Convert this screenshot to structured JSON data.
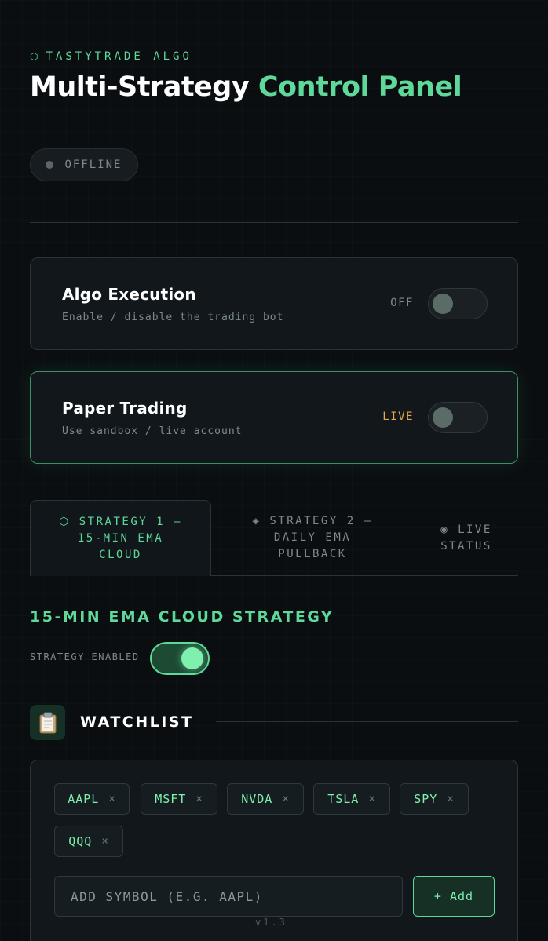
{
  "brand": {
    "icon": "hexagon-icon",
    "label": "TASTYTRADE ALGO"
  },
  "header": {
    "title_main": "Multi-Strategy ",
    "title_accent": "Control Panel"
  },
  "status": {
    "label": "OFFLINE",
    "dot_color": "#5a666c"
  },
  "cards": [
    {
      "title": "Algo Execution",
      "subtitle": "Enable / disable the trading bot",
      "state": "OFF",
      "state_color": "#7d8a91",
      "enabled": false
    },
    {
      "title": "Paper Trading",
      "subtitle": "Use sandbox / live account",
      "state": "LIVE",
      "state_color": "#e6a64a",
      "enabled": false
    }
  ],
  "tabs": [
    {
      "icon": "⬡",
      "label": "STRATEGY 1 — 15-MIN EMA CLOUD",
      "line1": "STRATEGY 1 —",
      "line2": "15-MIN EMA",
      "line3": "CLOUD",
      "active": true
    },
    {
      "icon": "◈",
      "label": "STRATEGY 2 — DAILY EMA PULLBACK",
      "line1": "STRATEGY 2 —",
      "line2": "DAILY EMA",
      "line3": "PULLBACK",
      "active": false
    },
    {
      "icon": "◉",
      "label": "LIVE STATUS",
      "line1": "LIVE",
      "line2": "STATUS",
      "active": false
    }
  ],
  "strategy": {
    "title": "15-MIN EMA CLOUD STRATEGY",
    "enabled_label": "STRATEGY ENABLED",
    "enabled": true
  },
  "watchlist": {
    "icon": "clipboard-icon",
    "title": "WATCHLIST",
    "symbols": [
      "AAPL",
      "MSFT",
      "NVDA",
      "TSLA",
      "SPY",
      "QQQ"
    ],
    "remove_glyph": "×",
    "input_placeholder": "ADD SYMBOL (E.G. AAPL)",
    "add_label": "+ Add"
  },
  "footer": {
    "version": "v1.3"
  },
  "colors": {
    "accent": "#5fd99a",
    "background": "#0b0e11",
    "card": "#12171b",
    "warning": "#e6a64a"
  }
}
